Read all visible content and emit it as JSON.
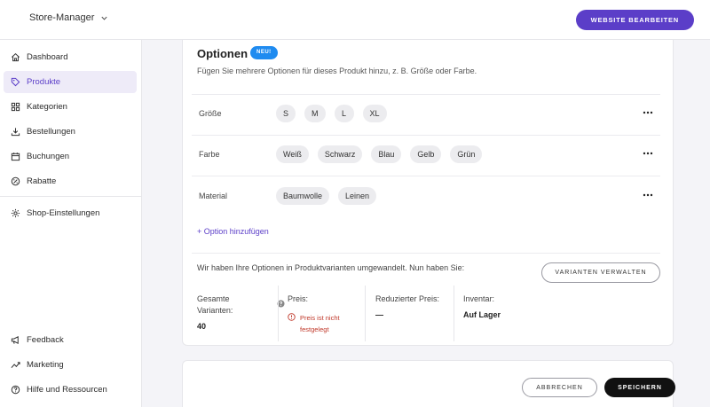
{
  "header": {
    "store_name": "Store-Manager",
    "website_button": "WEBSITE BEARBEITEN"
  },
  "sidebar": {
    "items": [
      {
        "label": "Dashboard",
        "icon": "home-icon"
      },
      {
        "label": "Produkte",
        "icon": "tag-icon",
        "active": true
      },
      {
        "label": "Kategorien",
        "icon": "grid-icon"
      },
      {
        "label": "Bestellungen",
        "icon": "download-icon"
      },
      {
        "label": "Buchungen",
        "icon": "calendar-icon"
      },
      {
        "label": "Rabatte",
        "icon": "discount-icon"
      },
      {
        "label": "Shop-Einstellungen",
        "icon": "gear-icon"
      }
    ],
    "bottom_items": [
      {
        "label": "Feedback",
        "icon": "megaphone-icon"
      },
      {
        "label": "Marketing",
        "icon": "trend-icon"
      },
      {
        "label": "Hilfe und Ressourcen",
        "icon": "help-circle-icon"
      }
    ]
  },
  "options": {
    "title": "Optionen",
    "badge": "NEU!",
    "description": "Fügen Sie mehrere Optionen für dieses Produkt hinzu, z. B. Größe oder Farbe.",
    "rows": [
      {
        "label": "Größe",
        "values": [
          "S",
          "M",
          "L",
          "XL"
        ]
      },
      {
        "label": "Farbe",
        "values": [
          "Weiß",
          "Schwarz",
          "Blau",
          "Gelb",
          "Grün"
        ]
      },
      {
        "label": "Material",
        "values": [
          "Baumwolle",
          "Leinen"
        ]
      }
    ],
    "add_option": "+ Option hinzufügen"
  },
  "variants": {
    "text": "Wir haben Ihre Optionen in Produktvarianten umgewandelt. Nun haben Sie:",
    "manage_button": "VARIANTEN VERWALTEN",
    "stats": {
      "total_label": "Gesamte Varianten:",
      "total_value": "40",
      "price_label": "Preis:",
      "price_error": "Preis ist nicht festgelegt",
      "reduced_label": "Reduzierter Preis:",
      "reduced_value": "—",
      "inventory_label": "Inventar:",
      "inventory_value": "Auf Lager"
    }
  },
  "footer": {
    "cancel": "ABBRECHEN",
    "save": "SPEICHERN"
  },
  "colors": {
    "accent": "#5b3ec8",
    "badge": "#1f8bf0",
    "error": "#c0392b"
  }
}
